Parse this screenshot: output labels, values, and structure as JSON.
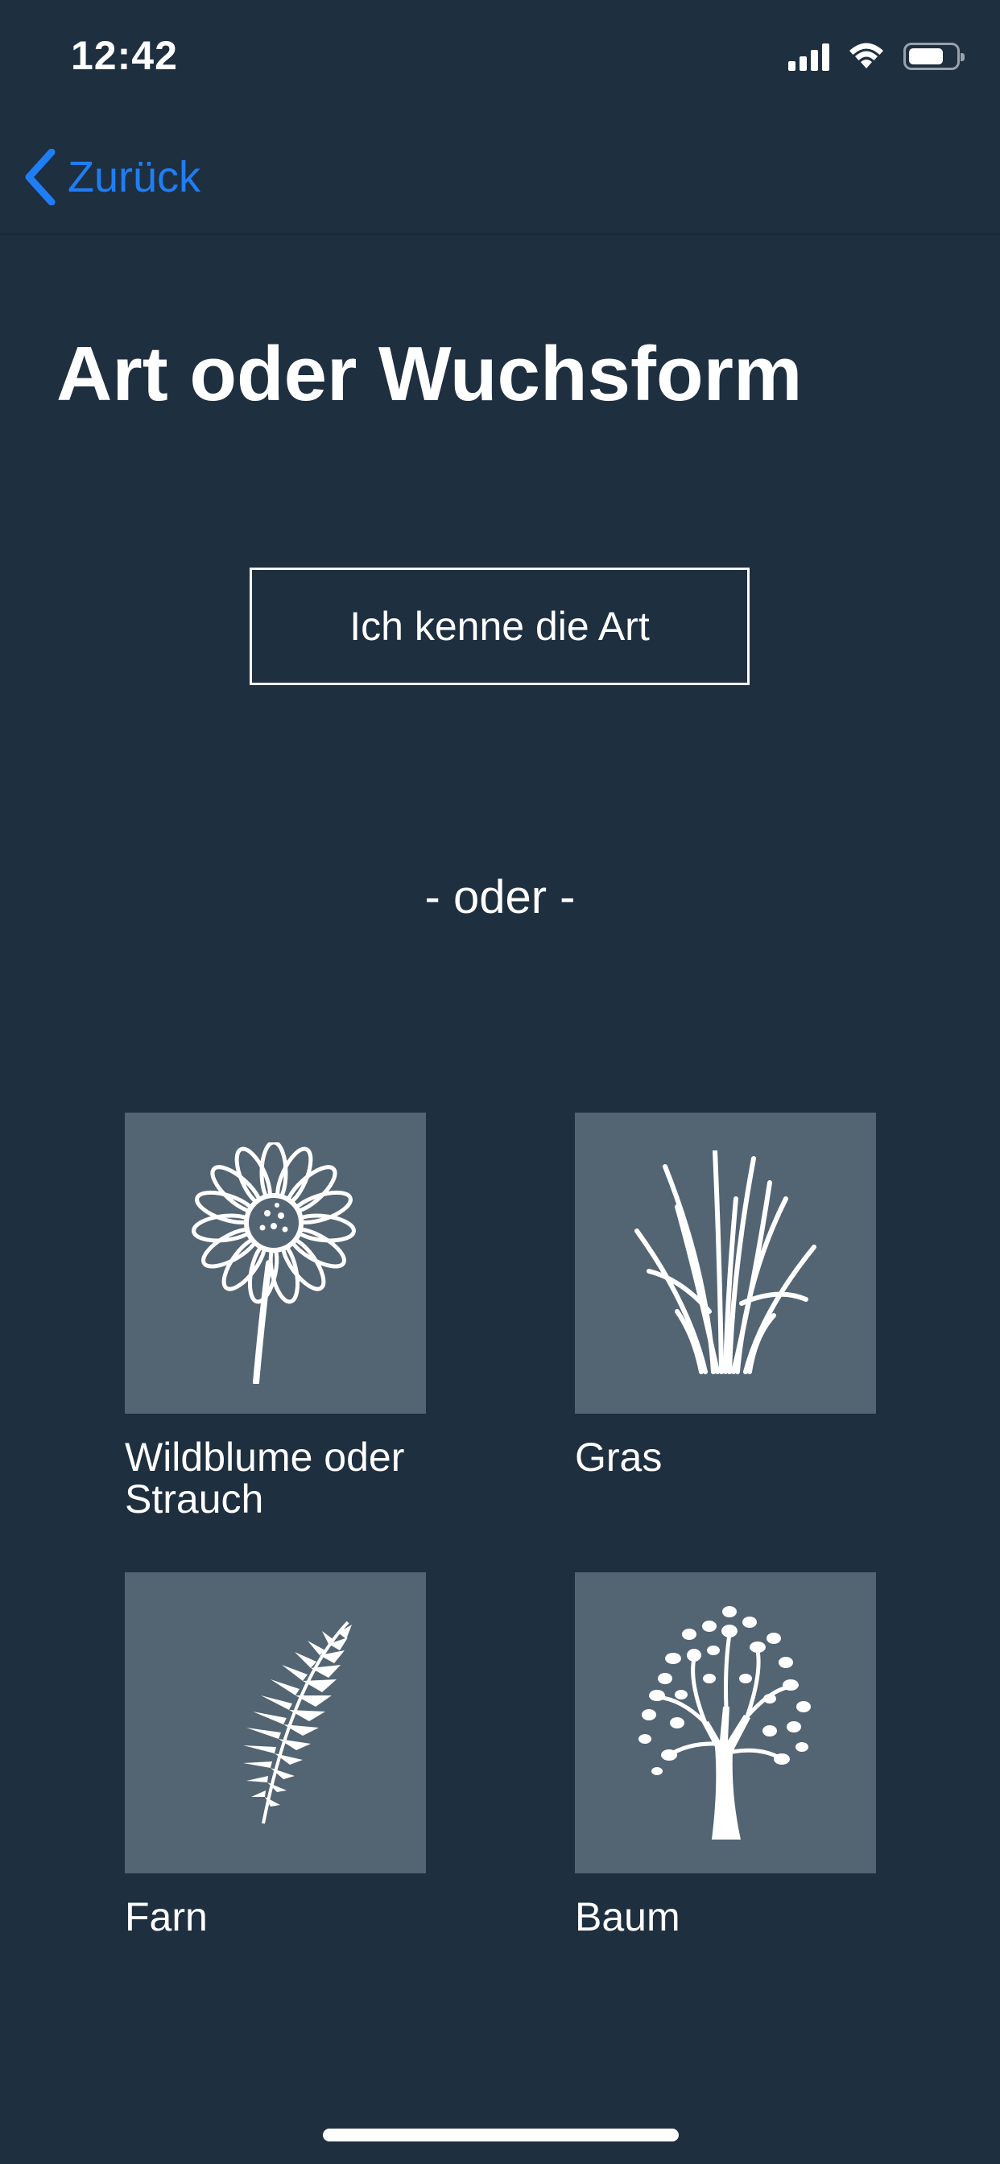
{
  "status_bar": {
    "time": "12:42",
    "battery_level": 0.75
  },
  "nav": {
    "back_label": "Zurück"
  },
  "page": {
    "title": "Art oder Wuchsform",
    "know_species_label": "Ich kenne die Art",
    "separator": "- oder -"
  },
  "growth_forms": [
    {
      "label": "Wildblume oder Strauch",
      "icon": "flower-icon"
    },
    {
      "label": "Gras",
      "icon": "grass-icon"
    },
    {
      "label": "Farn",
      "icon": "fern-icon"
    },
    {
      "label": "Baum",
      "icon": "tree-icon"
    }
  ],
  "colors": {
    "background": "#1e2f40",
    "accent": "#1f7ef5",
    "tile": "#536473",
    "text": "#ffffff"
  }
}
